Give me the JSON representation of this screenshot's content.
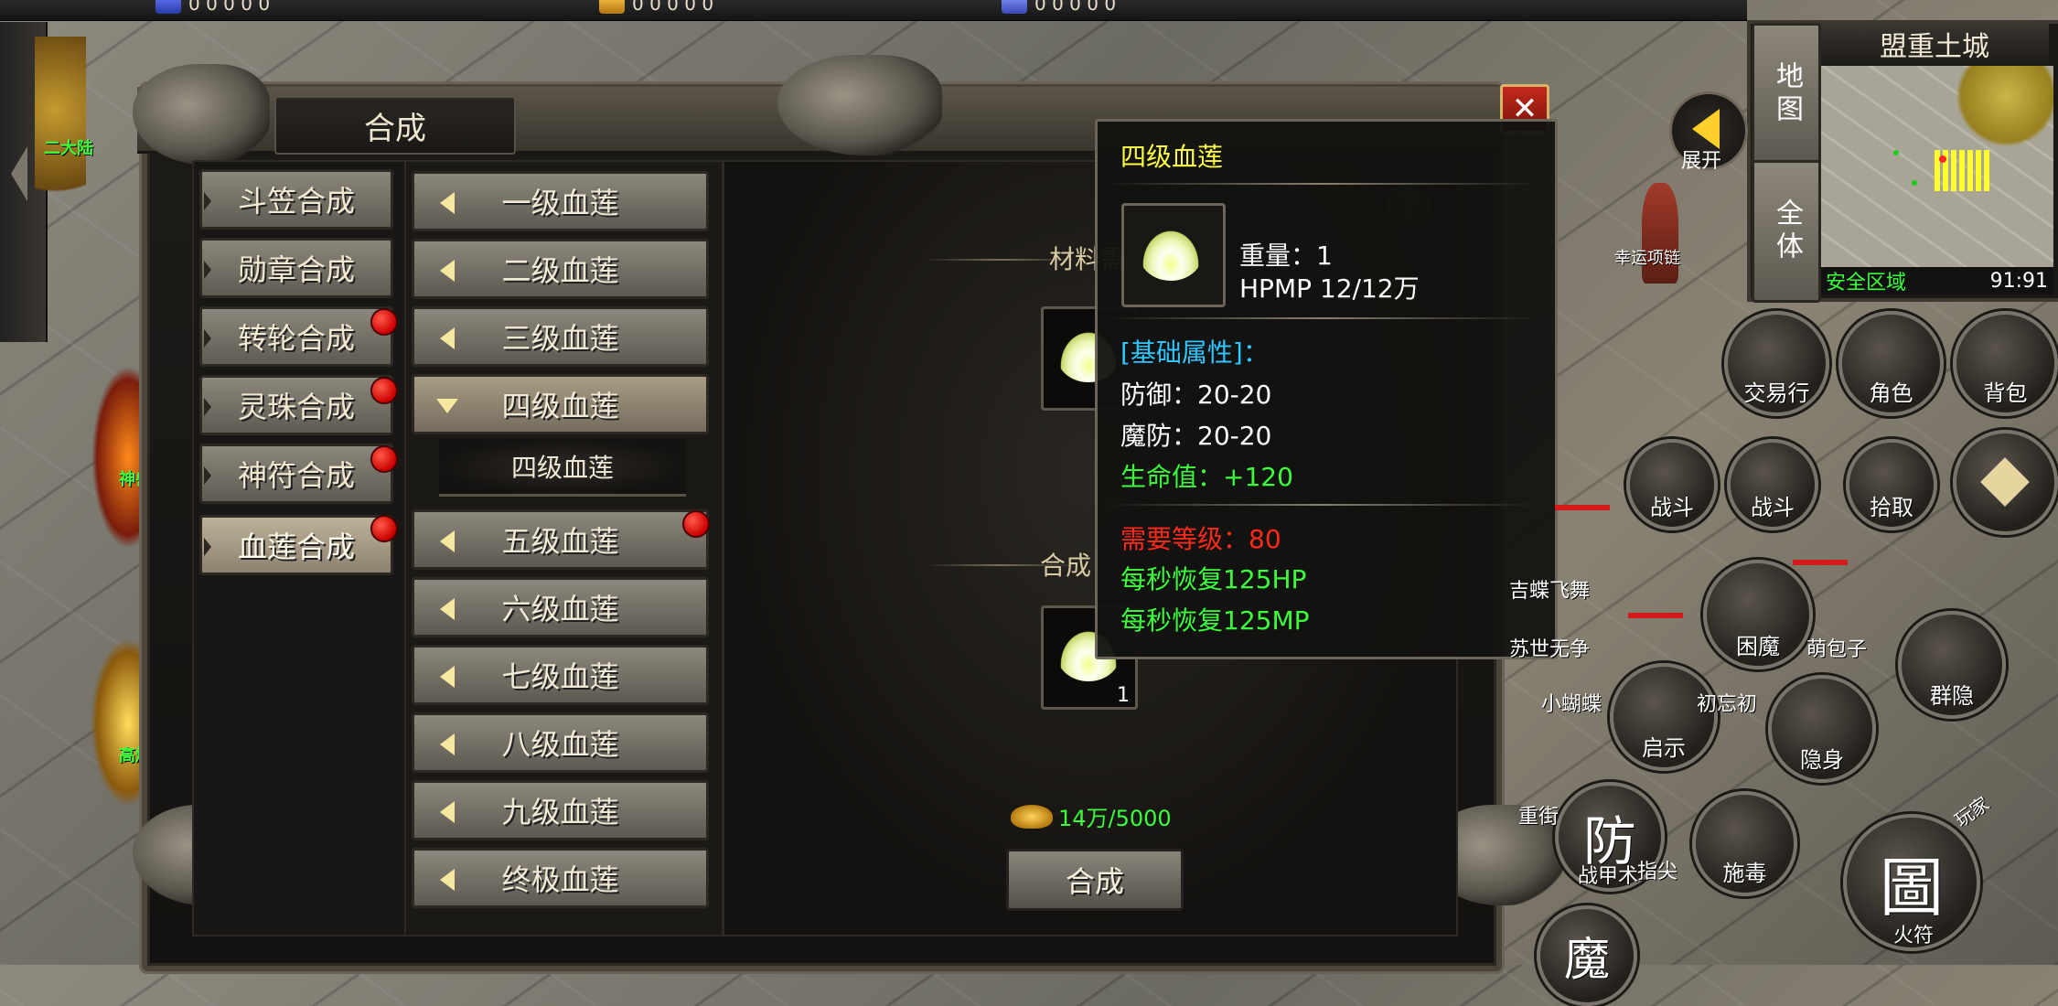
{
  "topbar": {
    "res1_value": "0 0 0 0 0",
    "res2_value": "0 0 0 0 0",
    "res3_value": "0 0 0 0 0"
  },
  "left_labels": {
    "area": "二大陆",
    "npc1": "神兽",
    "npc2": "高爆"
  },
  "window": {
    "title": "合成",
    "close": "✕",
    "categories": [
      {
        "label": "斗笠合成",
        "dot": false
      },
      {
        "label": "勋章合成",
        "dot": false
      },
      {
        "label": "转轮合成",
        "dot": true
      },
      {
        "label": "灵珠合成",
        "dot": true
      },
      {
        "label": "神符合成",
        "dot": true
      },
      {
        "label": "血莲合成",
        "dot": true,
        "active": true
      }
    ],
    "items": [
      {
        "label": "一级血莲"
      },
      {
        "label": "二级血莲"
      },
      {
        "label": "三级血莲"
      },
      {
        "label": "四级血莲",
        "open": true
      },
      {
        "label": "五级血莲",
        "dot": true
      },
      {
        "label": "六级血莲"
      },
      {
        "label": "七级血莲"
      },
      {
        "label": "八级血莲"
      },
      {
        "label": "九级血莲"
      },
      {
        "label": "终极血莲"
      }
    ],
    "sub_item": "四级血莲",
    "materials_label": "材料需求",
    "craft_label": "合成",
    "result_count": "1",
    "cost": "14万/5000",
    "craft_button": "合成"
  },
  "tooltip": {
    "title": "四级血莲",
    "weight": "重量：1",
    "hpmp": "HPMP 12/12万",
    "base_header": "[基础属性]：",
    "defense": "防御：20-20",
    "magic_def": "魔防：20-20",
    "hp": "生命值：+120",
    "req_level": "需要等级：80",
    "regen_hp": "每秒恢复125HP",
    "regen_mp": "每秒恢复125MP"
  },
  "hud": {
    "map_name": "盟重土城",
    "map_btn": "地图",
    "all_btn": "全体",
    "safe_zone": "安全区域",
    "coords": "91:91",
    "expand": "展开",
    "trade": "交易行",
    "character": "角色",
    "bag": "背包",
    "fight1": "战斗",
    "fight2": "战斗",
    "pickup": "拾取",
    "kunmo": "困魔",
    "qunyin": "群隐",
    "qishi": "启示",
    "yinshen": "隐身",
    "fang": "防",
    "zhanjia": "战甲术",
    "shidu": "施毒",
    "tuan": "圖",
    "huofu": "火符",
    "wanjia": "玩家",
    "mo": "魔",
    "npc_guard": "幸运项链"
  },
  "players": [
    "吉蝶飞舞",
    "苏世无争",
    "小蝴蝶",
    "初忘初",
    "萌包子",
    "重街",
    "指尖"
  ]
}
